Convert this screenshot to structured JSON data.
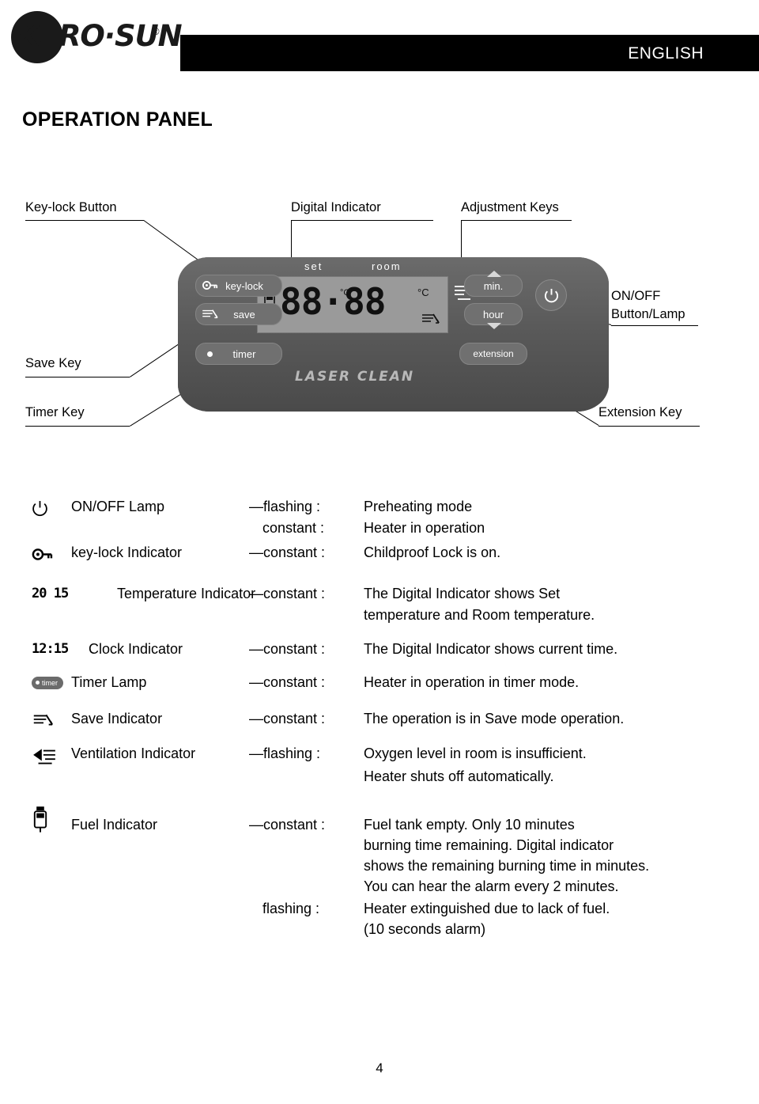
{
  "header": {
    "brand": "KERO·SUN",
    "brand_reg": "®",
    "language": "ENGLISH"
  },
  "page_title": "OPERATION PANEL",
  "callouts": {
    "key_lock_button": "Key-lock Button",
    "digital_indicator": "Digital Indicator",
    "adjustment_keys": "Adjustment Keys",
    "on_off_button_lamp_line1": "ON/OFF",
    "on_off_button_lamp_line2": "Button/Lamp",
    "save_key": "Save Key",
    "timer_key": "Timer Key",
    "extension_key": "Extension Key"
  },
  "panel": {
    "key_lock_label": "key-lock",
    "save_label": "save",
    "timer_label": "timer",
    "min_label": "min.",
    "hour_label": "hour",
    "extension_label": "extension",
    "set_label": "set",
    "room_label": "room",
    "lcd_value": "88·88",
    "lcd_deg_left": "°C",
    "lcd_deg_right": "°C",
    "brand_mark": "LASER CLEAN",
    "power_glyph": "⏻"
  },
  "legend": [
    {
      "icon": "power-icon",
      "name": "ON/OFF Lamp",
      "states": [
        "—flashing :",
        "constant :"
      ],
      "desc": [
        "Preheating mode",
        "Heater in operation"
      ]
    },
    {
      "icon": "key-lock-icon",
      "name": "key-lock Indicator",
      "states": [
        "—constant :"
      ],
      "desc": [
        "Childproof Lock is on."
      ]
    },
    {
      "icon": "temperature-digits-icon",
      "icon_text": "20  15",
      "name": "Temperature Indicator",
      "states": [
        "—constant :"
      ],
      "desc": [
        "The Digital Indicator shows Set",
        "temperature and Room temperature."
      ]
    },
    {
      "icon": "clock-digits-icon",
      "icon_text": "12:15",
      "name": "Clock Indicator",
      "states": [
        "—constant :"
      ],
      "desc": [
        "The Digital Indicator shows current time."
      ]
    },
    {
      "icon": "timer-lamp-icon",
      "icon_text": "timer",
      "name": "Timer Lamp",
      "states": [
        "—constant :"
      ],
      "desc": [
        "Heater in operation in timer mode."
      ]
    },
    {
      "icon": "save-icon",
      "name": "Save Indicator",
      "states": [
        "—constant :"
      ],
      "desc": [
        "The operation is in Save mode operation."
      ]
    },
    {
      "icon": "ventilation-icon",
      "name": "Ventilation Indicator",
      "states": [
        "—flashing :"
      ],
      "desc": [
        "Oxygen level in room is insufficient.",
        "Heater shuts off automatically."
      ]
    },
    {
      "icon": "fuel-icon",
      "name": "Fuel Indicator",
      "states": [
        "—constant :",
        "flashing :"
      ],
      "desc": [
        "Fuel tank empty. Only 10 minutes",
        "burning time remaining. Digital indicator",
        "shows the remaining burning time in minutes.",
        "You can hear the alarm every 2 minutes.",
        "Heater extinguished due to lack of fuel.",
        "(10 seconds alarm)"
      ]
    }
  ],
  "page_number": "4"
}
